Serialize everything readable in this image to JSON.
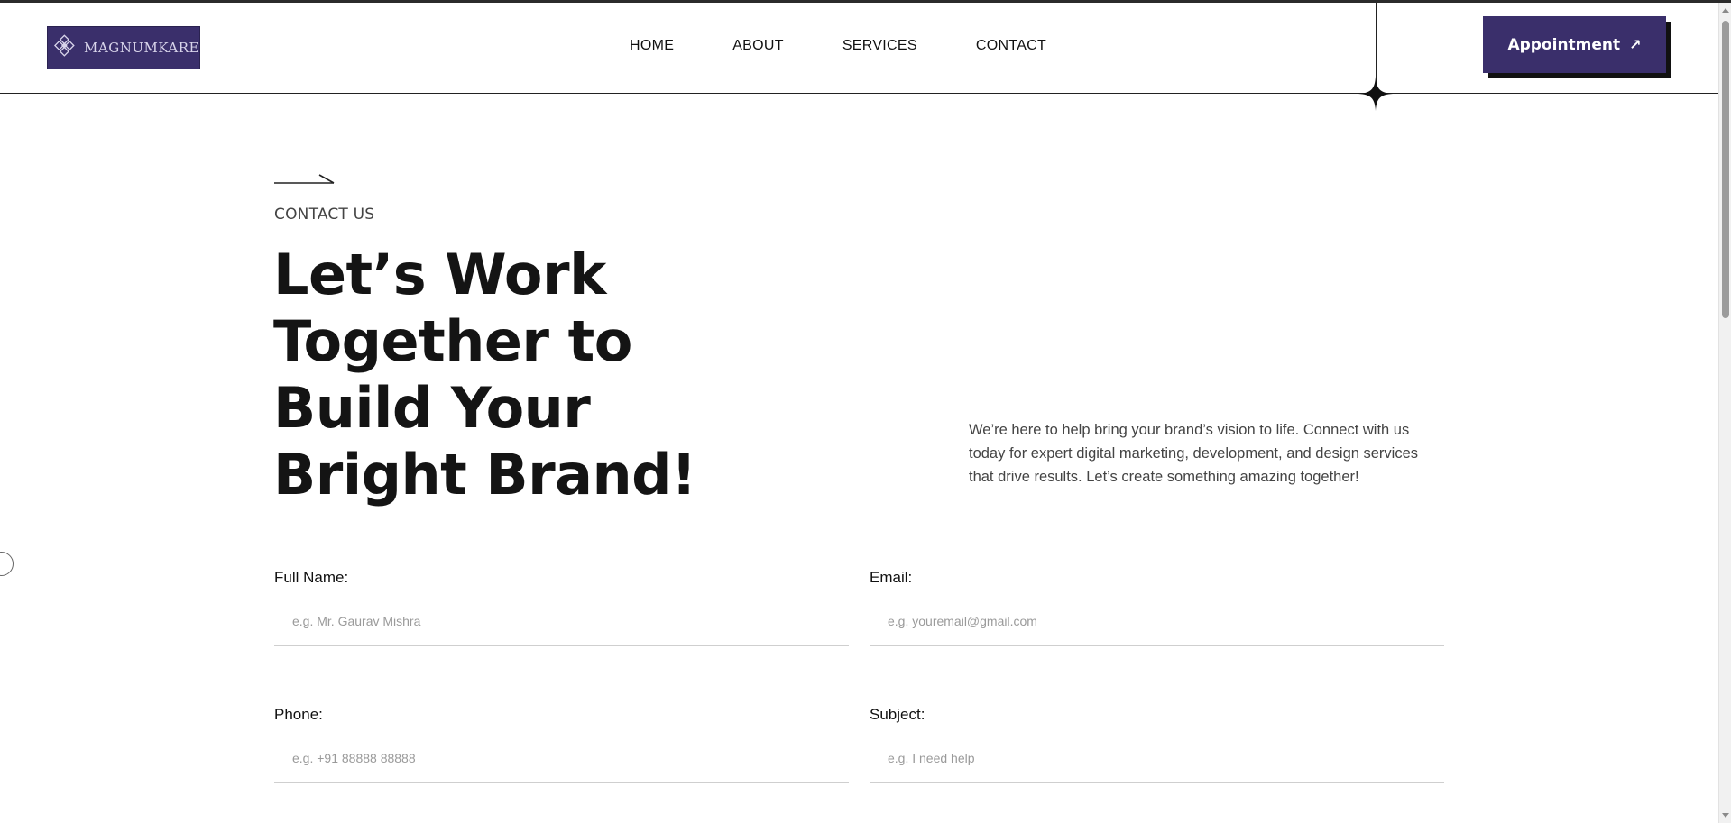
{
  "brand": {
    "logo_text": "MAGNUMKARE",
    "accent": "#3a2f6b"
  },
  "nav": {
    "items": [
      {
        "label": "HOME"
      },
      {
        "label": "ABOUT"
      },
      {
        "label": "SERVICES"
      },
      {
        "label": "CONTACT"
      }
    ]
  },
  "header": {
    "cta_label": "Appointment",
    "cta_icon": "arrow-up-right-icon"
  },
  "hero": {
    "kicker": "CONTACT US",
    "headline": "Let’s Work Together to Build Your Bright Brand!",
    "intro": "We’re here to help bring your brand’s vision to life. Connect with us today for expert digital marketing, development, and design services that drive results. Let’s create something amazing together!"
  },
  "form": {
    "full_name": {
      "label": "Full Name:",
      "placeholder": "e.g. Mr. Gaurav Mishra"
    },
    "email": {
      "label": "Email:",
      "placeholder": "e.g. youremail@gmail.com"
    },
    "phone": {
      "label": "Phone:",
      "placeholder": "e.g. +91 88888 88888"
    },
    "subject": {
      "label": "Subject:",
      "placeholder": "e.g. I need help"
    }
  }
}
